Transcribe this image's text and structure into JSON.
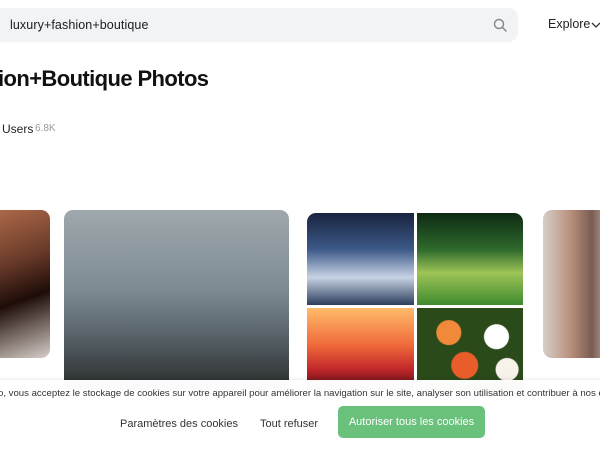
{
  "header": {
    "search_value": "luxury+fashion+boutique",
    "explore_label": "Explore"
  },
  "page": {
    "title": "ion+Boutique Photos",
    "users_label": "Users",
    "users_count": "6.8K"
  },
  "cookie_banner": {
    "text": "o, vous acceptez le stockage de cookies sur votre appareil pour améliorer la navigation sur le site, analyser son utilisation et contribuer à nos ef",
    "settings_label": "Paramètres des cookies",
    "refuse_label": "Tout refuser",
    "accept_label": "Autoriser tous les cookies",
    "accept_color": "#6ac17c"
  },
  "icons": {
    "search": "search-icon",
    "explore_chevron": "chevron-down-icon"
  }
}
